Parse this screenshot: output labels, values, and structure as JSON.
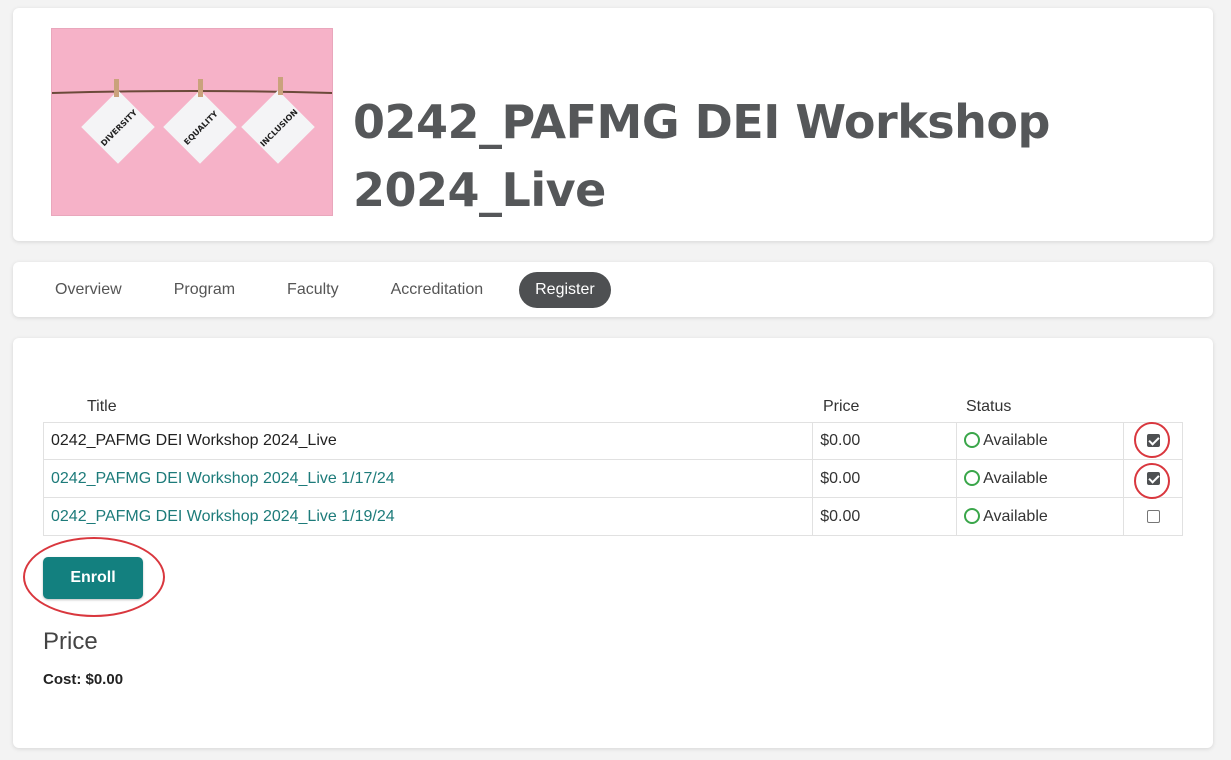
{
  "header": {
    "title": "0242_PAFMG DEI Workshop 2024_Live",
    "image_cards": [
      "DIVERSITY",
      "EQUALITY",
      "INCLUSION"
    ]
  },
  "tabs": [
    {
      "label": "Overview",
      "active": false
    },
    {
      "label": "Program",
      "active": false
    },
    {
      "label": "Faculty",
      "active": false
    },
    {
      "label": "Accreditation",
      "active": false
    },
    {
      "label": "Register",
      "active": true
    }
  ],
  "registration": {
    "columns": {
      "title": "Title",
      "price": "Price",
      "status": "Status"
    },
    "rows": [
      {
        "title": "0242_PAFMG DEI Workshop 2024_Live",
        "price": "$0.00",
        "status": "Available",
        "checked": true,
        "level": "main"
      },
      {
        "title": "0242_PAFMG DEI Workshop 2024_Live 1/17/24",
        "price": "$0.00",
        "status": "Available",
        "checked": true,
        "level": "sub"
      },
      {
        "title": "0242_PAFMG DEI Workshop 2024_Live 1/19/24",
        "price": "$0.00",
        "status": "Available",
        "checked": false,
        "level": "sub"
      }
    ],
    "enroll_label": "Enroll"
  },
  "price_section": {
    "heading": "Price",
    "cost": "Cost: $0.00"
  },
  "colors": {
    "accent": "#13807f",
    "link": "#1d7b7a",
    "active_tab": "#4e5052",
    "available": "#3aa64a",
    "annotation": "#d9373e",
    "hero_bg": "#f6b2c8"
  }
}
